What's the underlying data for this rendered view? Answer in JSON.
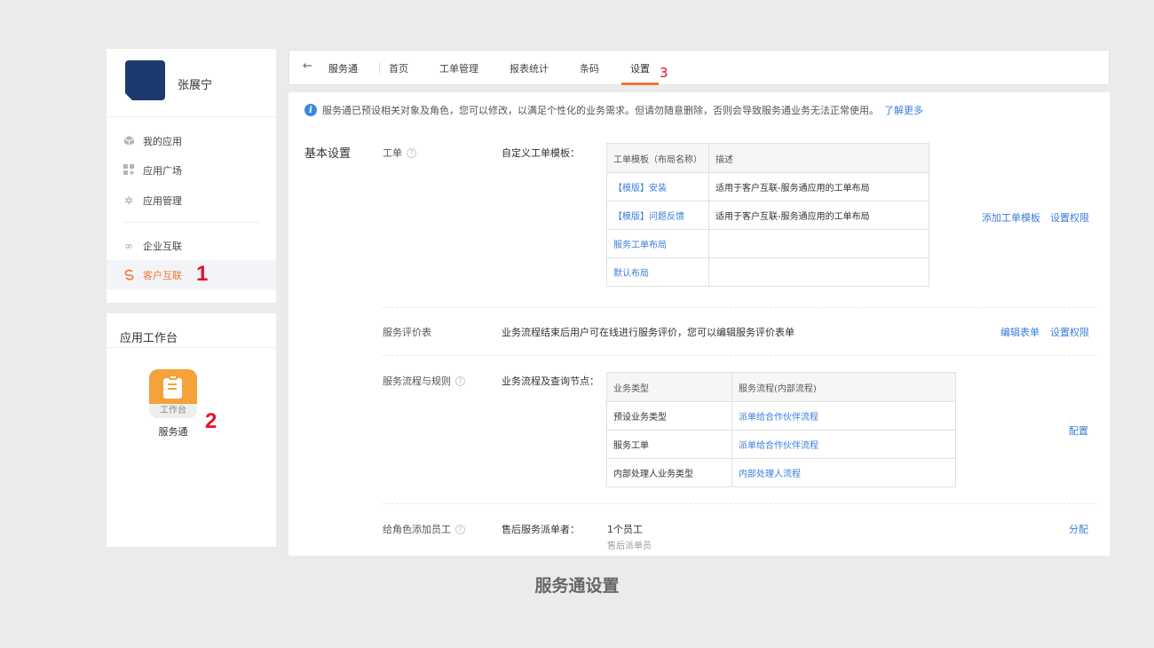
{
  "sidebar": {
    "user_name": "张展宁",
    "nav": [
      {
        "label": "我的应用",
        "icon": "cube-icon"
      },
      {
        "label": "应用广场",
        "icon": "grid-plus-icon"
      },
      {
        "label": "应用管理",
        "icon": "gear-icon"
      },
      {
        "label": "企业互联",
        "icon": "link-icon"
      },
      {
        "label": "客户互联",
        "icon": "customer-link-icon",
        "active": true
      }
    ],
    "marker_1": "1"
  },
  "workbench": {
    "title": "应用工作台",
    "tile_label": "工作台",
    "app_name": "服务通",
    "marker_2": "2"
  },
  "topbar": {
    "back_icon": "arrow-left-icon",
    "app_title": "服务通",
    "tabs": [
      "首页",
      "工单管理",
      "报表统计",
      "条码",
      "设置"
    ],
    "active_tab": "设置",
    "marker_3": "3"
  },
  "notice": {
    "text": "服务通已预设相关对象及角色，您可以修改，以满足个性化的业务需求。但请勿随意删除，否则会导致服务通业务无法正常使用。",
    "link": "了解更多"
  },
  "section_title": "基本设置",
  "work_order": {
    "label": "工单",
    "sub_label": "自定义工单模板：",
    "headers": [
      "工单模板（布局名称）",
      "描述"
    ],
    "rows": [
      [
        "【模版】安装",
        "适用于客户互联-服务通应用的工单布局"
      ],
      [
        "【模版】问题反馈",
        "适用于客户互联-服务通应用的工单布局"
      ],
      [
        "服务工单布局",
        ""
      ],
      [
        "默认布局",
        ""
      ]
    ],
    "actions": [
      "添加工单模板",
      "设置权限"
    ]
  },
  "evaluation": {
    "label": "服务评价表",
    "description": "业务流程结束后用户可在线进行服务评价，您可以编辑服务评价表单",
    "actions": [
      "编辑表单",
      "设置权限"
    ]
  },
  "process": {
    "label": "服务流程与规则",
    "sub_label": "业务流程及查询节点：",
    "headers": [
      "业务类型",
      "服务流程(内部流程)"
    ],
    "rows": [
      [
        "预设业务类型",
        "派单给合作伙伴流程"
      ],
      [
        "服务工单",
        "派单给合作伙伴流程"
      ],
      [
        "内部处理人业务类型",
        "内部处理人流程"
      ]
    ],
    "action": "配置"
  },
  "roles": {
    "label": "给角色添加员工",
    "sub_label": "售后服务派单者：",
    "count": "1个员工",
    "role_name": "售后派单员",
    "action": "分配"
  },
  "caption": "服务通设置",
  "colors": {
    "accent": "#f07636",
    "link": "#3a7ed9",
    "marker": "#e8102a",
    "avatar": "#1c3a6e",
    "tile": "#f5a23a"
  }
}
